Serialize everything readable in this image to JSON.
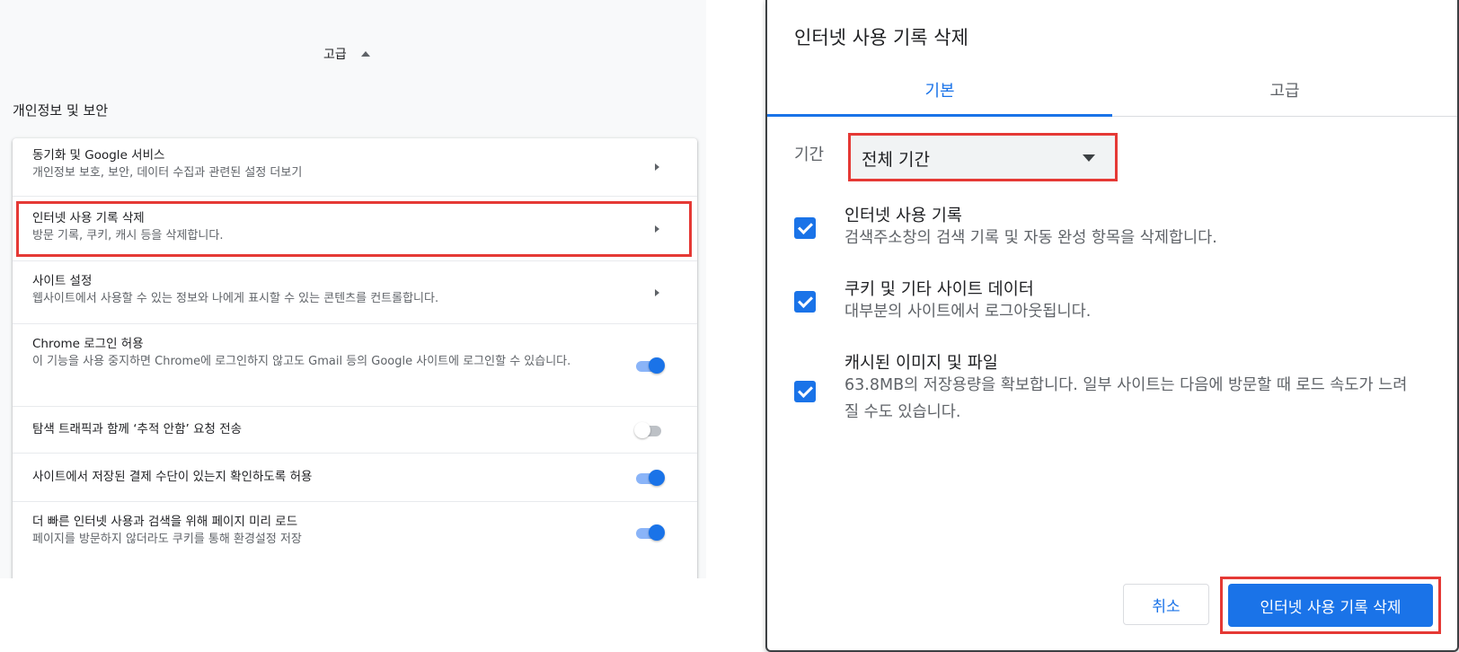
{
  "settings": {
    "advanced_toggle_label": "고급",
    "section_heading": "개인정보 및 보안",
    "rows": [
      {
        "title": "동기화 및 Google 서비스",
        "subtitle": "개인정보 보호, 보안, 데이터 수집과 관련된 설정 더보기",
        "control": "chevron"
      },
      {
        "title": "인터넷 사용 기록 삭제",
        "subtitle": "방문 기록, 쿠키, 캐시 등을 삭제합니다.",
        "control": "chevron"
      },
      {
        "title": "사이트 설정",
        "subtitle": "웹사이트에서 사용할 수 있는 정보와 나에게 표시할 수 있는 콘텐츠를 컨트롤합니다.",
        "control": "chevron"
      },
      {
        "title": "Chrome 로그인 허용",
        "subtitle": "이 기능을 사용 중지하면 Chrome에 로그인하지 않고도 Gmail 등의 Google 사이트에 로그인할 수 있습니다.",
        "control": "toggle",
        "enabled": true
      },
      {
        "title": "탐색 트래픽과 함께 ‘추적 안함’ 요청 전송",
        "subtitle": "",
        "control": "toggle",
        "enabled": false
      },
      {
        "title": "사이트에서 저장된 결제 수단이 있는지 확인하도록 허용",
        "subtitle": "",
        "control": "toggle",
        "enabled": true
      },
      {
        "title": "더 빠른 인터넷 사용과 검색을 위해 페이지 미리 로드",
        "subtitle": "페이지를 방문하지 않더라도 쿠키를 통해 환경설정 저장",
        "control": "toggle",
        "enabled": true
      }
    ]
  },
  "dialog": {
    "title": "인터넷 사용 기록 삭제",
    "tabs": [
      {
        "label": "기본",
        "active": true
      },
      {
        "label": "고급",
        "active": false
      }
    ],
    "period_label": "기간",
    "period_value": "전체 기간",
    "items": [
      {
        "title": "인터넷 사용 기록",
        "desc": "검색주소창의 검색 기록 및 자동 완성 항목을 삭제합니다.",
        "checked": true
      },
      {
        "title": "쿠키 및 기타 사이트 데이터",
        "desc": "대부분의 사이트에서 로그아웃됩니다.",
        "checked": true
      },
      {
        "title": "캐시된 이미지 및 파일",
        "desc": "63.8MB의 저장용량을 확보합니다. 일부 사이트는 다음에 방문할 때 로드 속도가 느려질 수도 있습니다.",
        "checked": true
      }
    ],
    "cancel_label": "취소",
    "confirm_label": "인터넷 사용 기록 삭제"
  },
  "colors": {
    "accent": "#1a73e8",
    "highlight_box": "#e53935"
  }
}
